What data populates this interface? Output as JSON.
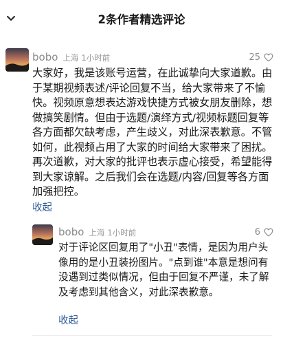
{
  "header": {
    "back_icon": "chevron-down-icon",
    "title": "2条作者精选评论"
  },
  "comments": [
    {
      "username": "bobo",
      "location": "上海",
      "time": "1小时前",
      "likes": "25",
      "like_icon": "heart-icon",
      "text": "大家好，我是该账号运营，在此诚挚向大家道歉。由于某期视频表述/评论回复不当，给大家带来了不愉快。视频原意想表达游戏快捷方式被女朋友删除，想做搞笑剧情。但由于选题/演绎方式/视频标题回复等各方面都欠缺考虑，产生歧义，对此深表歉意。不管如何，此视频占用了大家的时间给大家带来了困扰。再次道歉，对大家的批评也表示虚心接受，希望能得到大家谅解。之后我们会在选题/内容/回复等各方面加强把控。",
      "collapse": "收起"
    },
    {
      "username": "bobo",
      "location": "上海",
      "time": "1小时前",
      "likes": "6",
      "like_icon": "heart-icon",
      "text": "对于评论区回复用了\"小丑\"表情，是因为用户头像用的是小丑装扮图片。\"点到谁\"本意是想问有没遇到过类似情况，但由于回复不严谨，未了解及考虑到其他含义，对此深表歉意。",
      "collapse": "收起"
    }
  ]
}
